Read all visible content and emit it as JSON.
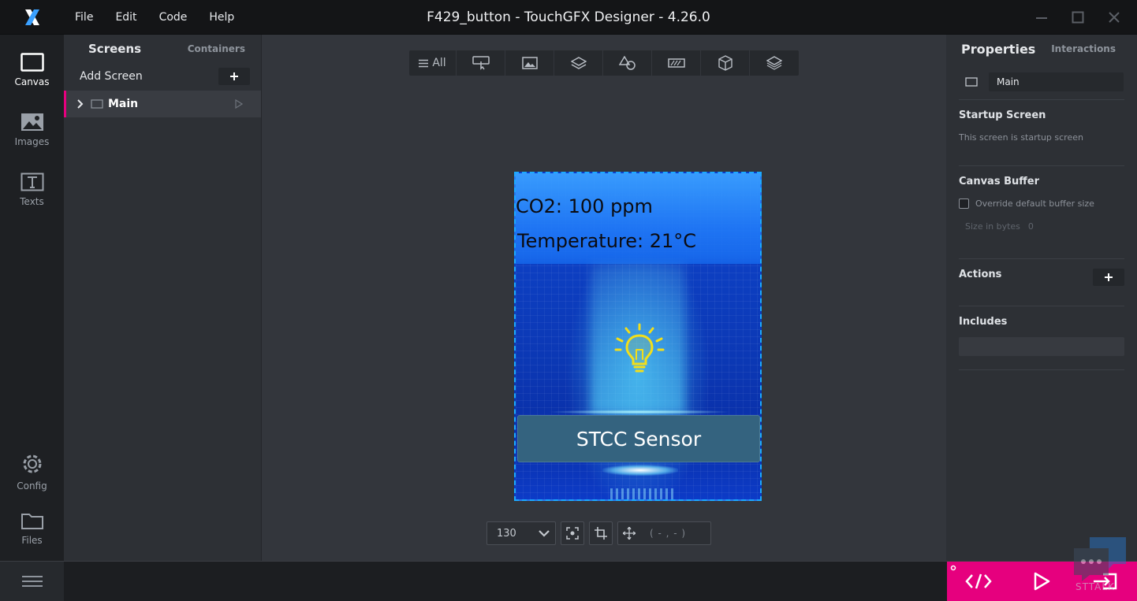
{
  "app": {
    "window_title": "F429_button - TouchGFX Designer - 4.26.0",
    "menu": [
      "File",
      "Edit",
      "Code",
      "Help"
    ],
    "accent_color": "#e6007e"
  },
  "leftnav": {
    "items": [
      {
        "label": "Canvas",
        "icon": "canvas-icon"
      },
      {
        "label": "Images",
        "icon": "image-icon"
      },
      {
        "label": "Texts",
        "icon": "text-icon"
      }
    ],
    "bottom_items": [
      {
        "label": "Config",
        "icon": "gear-icon"
      },
      {
        "label": "Files",
        "icon": "folder-icon"
      }
    ]
  },
  "screens_panel": {
    "tab_active": "Screens",
    "tab_inactive": "Containers",
    "add_label": "Add Screen",
    "screens": [
      {
        "name": "Main"
      }
    ]
  },
  "toolbar": {
    "all_label": "All"
  },
  "device": {
    "co2_text": "CO2: 100 ppm",
    "temp_text": "Temperature:  21°C",
    "button_label": "STCC Sensor"
  },
  "zoom": {
    "value": "130",
    "coords": "( - , - )"
  },
  "properties": {
    "tab_active": "Properties",
    "tab_inactive": "Interactions",
    "screen_name": "Main",
    "startup_title": "Startup Screen",
    "startup_sub": "This screen is startup screen",
    "buffer_title": "Canvas Buffer",
    "buffer_override": "Override default buffer size",
    "buffer_size_label": "Size in bytes",
    "buffer_size_value": "0",
    "actions_title": "Actions",
    "includes_title": "Includes"
  },
  "bottom": {
    "watermark": "STTALK"
  }
}
